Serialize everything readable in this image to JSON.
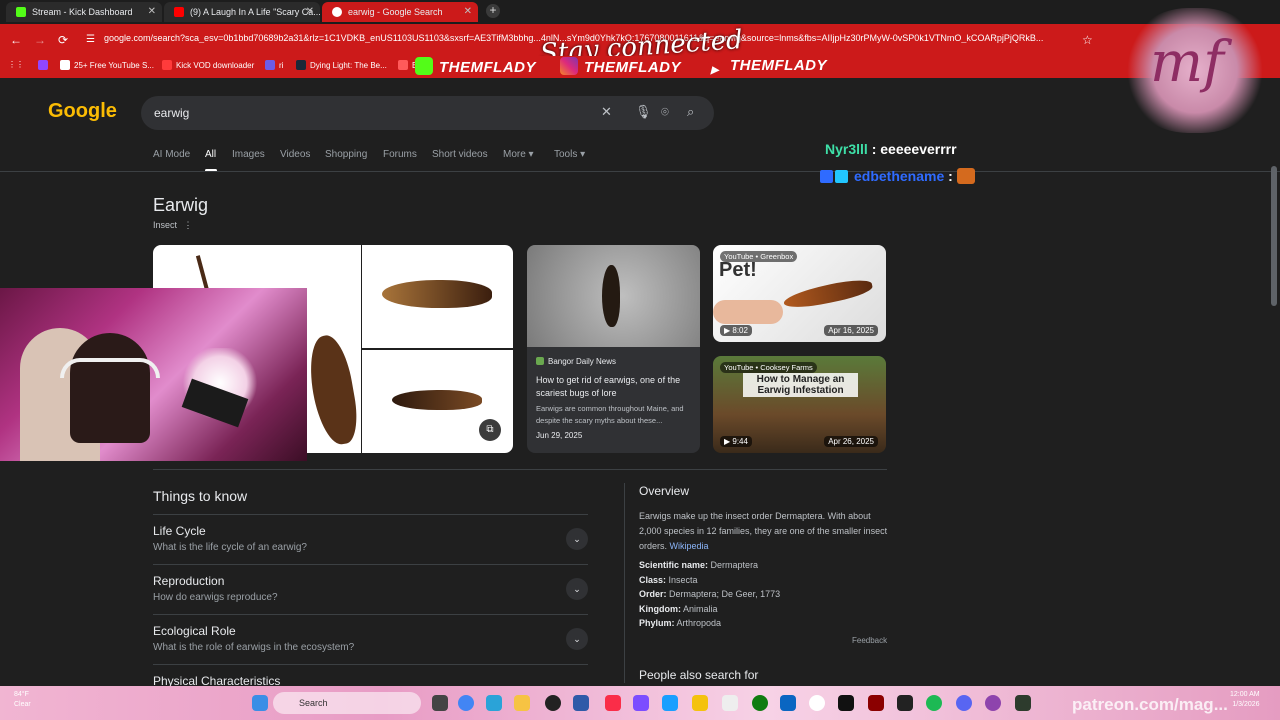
{
  "browser": {
    "tabs": [
      {
        "title": "Stream - Kick Dashboard",
        "favicon_color": "#53fc18"
      },
      {
        "title": "(9) A Laugh In A Life \"Scary Ca...",
        "favicon_color": "#ff0000"
      },
      {
        "title": "earwig - Google Search",
        "favicon_color": "#ffffff"
      }
    ],
    "new_tab_label": "+",
    "url": "google.com/search?sca_esv=0b1bbd70689b2a31&rlz=1C1VDKB_enUS1103US1103&sxsrf=AE3TifM3bbhg...4nlN...sYm9d0Yhk7kQ:1767080011611&q=earwig&source=lnms&fbs=AIIjpHz30rPMyW-0vSP0k1VTNmO_kCOARpjPjQRkB...",
    "nav": {
      "back": "←",
      "forward": "→",
      "reload": "⟳",
      "star": "☆"
    },
    "bookmarks": [
      {
        "label": "25+ Free YouTube S...",
        "color": "#ffffff"
      },
      {
        "label": "Kick VOD downloader",
        "color": "#ff3b3b"
      },
      {
        "label": "ri",
        "color": "#6c5ce7"
      },
      {
        "label": "Dying Light: The Be...",
        "color": "#1b2838"
      },
      {
        "label": "En",
        "color": "#ff5a5a"
      }
    ],
    "brands": [
      {
        "label": "THEMFLADY",
        "icon": "kick-icon",
        "color": "#53fc18"
      },
      {
        "label": "THEMFLADY",
        "icon": "instagram-icon",
        "color": "#e1306c"
      },
      {
        "label": "THEMFLADY",
        "icon": "youtube-icon",
        "color": "#ff0000"
      }
    ],
    "stay_connected": "Stay connected"
  },
  "google": {
    "logo": "Google",
    "query": "earwig",
    "tabs": [
      "AI Mode",
      "All",
      "Images",
      "Videos",
      "Shopping",
      "Forums",
      "Short videos",
      "More ▾",
      "Tools ▾"
    ],
    "active_tab": "All"
  },
  "knowledge_panel": {
    "title": "Earwig",
    "subtitle": "Insect",
    "news_card": {
      "source": "Bangor Daily News",
      "title": "How to get rid of earwigs, one of the scariest bugs of lore",
      "snippet": "Earwigs are common throughout Maine, and despite the scary myths about these...",
      "date": "Jun 29, 2025"
    },
    "videos": [
      {
        "source": "YouTube • Greenbox",
        "overlay": "Pet!",
        "duration": "▶ 8:02",
        "date": "Apr 16, 2025"
      },
      {
        "source": "YouTube • Cooksey Farms",
        "overlay": "How to Manage an Earwig Infestation",
        "duration": "▶ 9:44",
        "date": "Apr 26, 2025"
      }
    ]
  },
  "things_to_know": {
    "title": "Things to know",
    "rows": [
      {
        "heading": "Life Cycle",
        "question": "What is the life cycle of an earwig?"
      },
      {
        "heading": "Reproduction",
        "question": "How do earwigs reproduce?"
      },
      {
        "heading": "Ecological Role",
        "question": "What is the role of earwigs in the ecosystem?"
      },
      {
        "heading": "Physical Characteristics",
        "question": ""
      }
    ]
  },
  "overview": {
    "title": "Overview",
    "text": "Earwigs make up the insect order Dermaptera. With about 2,000 species in 12 families, they are one of the smaller insect orders.",
    "link": "Wikipedia",
    "facts": [
      {
        "label": "Scientific name:",
        "value": "Dermaptera"
      },
      {
        "label": "Class:",
        "value": "Insecta"
      },
      {
        "label": "Order:",
        "value": "Dermaptera; De Geer, 1773"
      },
      {
        "label": "Kingdom:",
        "value": "Animalia"
      },
      {
        "label": "Phylum:",
        "value": "Arthropoda"
      }
    ],
    "feedback": "Feedback",
    "people_also_search": "People also search for"
  },
  "stream_overlay": {
    "chat": [
      {
        "user": "Nyr3lll",
        "sep": " : ",
        "message": "eeeeeverrrr",
        "user_color": "#3ee0a8"
      },
      {
        "user": "edbethename",
        "sep": " : ",
        "message": "",
        "user_color": "#2f6bff"
      }
    ],
    "watermark": "patreon.com/mag...",
    "logo_text": "mf"
  },
  "taskbar": {
    "search_placeholder": "Search",
    "weather_temp": "84°F",
    "weather_desc": "Clear",
    "time": "12:00 AM",
    "date": "1/3/2026"
  }
}
